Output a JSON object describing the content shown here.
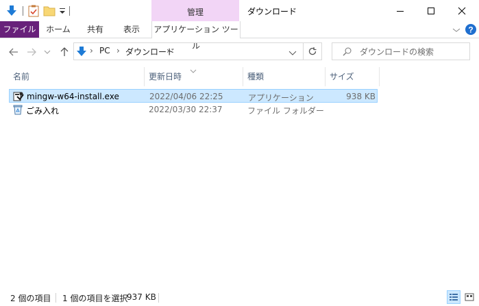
{
  "window": {
    "title": "ダウンロード",
    "context_tab_group": "管理",
    "buttons": {
      "minimize": "–",
      "maximize": "□",
      "close": "✕"
    }
  },
  "ribbon": {
    "tabs": [
      "ファイル",
      "ホーム",
      "共有",
      "表示",
      "アプリケーション ツール"
    ],
    "active_color": "#68217a",
    "context_color": "#f2d5f6"
  },
  "address": {
    "breadcrumb": [
      "PC",
      "ダウンロード"
    ],
    "search_placeholder": "ダウンロードの検索"
  },
  "columns": [
    "名前",
    "更新日時",
    "種類",
    "サイズ"
  ],
  "files": [
    {
      "name": "mingw-w64-install.exe",
      "date": "2022/04/06 22:25",
      "type": "アプリケーション",
      "size": "938 KB",
      "icon": "installer-icon",
      "selected": true
    },
    {
      "name": "ごみ入れ",
      "date": "2022/03/30 22:37",
      "type": "ファイル フォルダー",
      "size": "",
      "icon": "recycle-folder-icon",
      "selected": false
    }
  ],
  "status": {
    "item_count": "2 個の項目",
    "selection": "1 個の項目を選択",
    "selection_size": "937 KB"
  }
}
